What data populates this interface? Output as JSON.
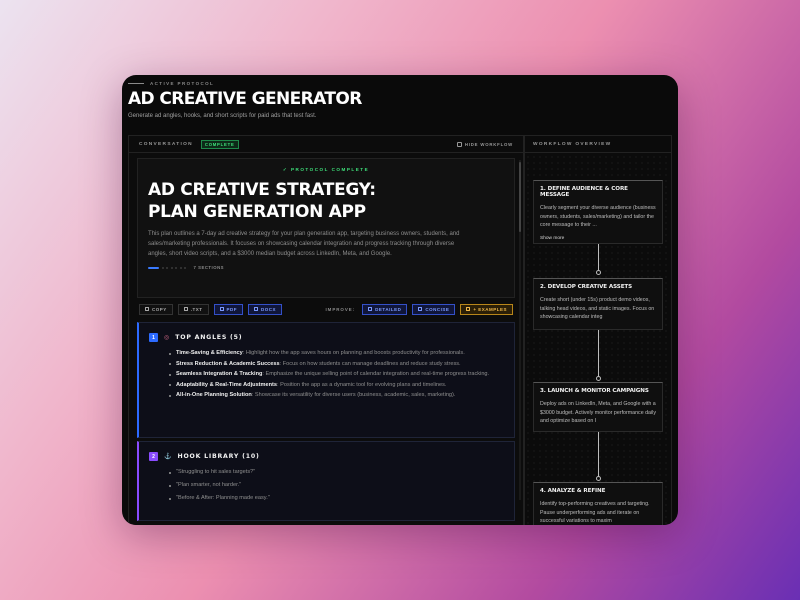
{
  "header": {
    "protocol_label": "ACTIVE PROTOCOL",
    "title": "AD CREATIVE GENERATOR",
    "subtitle": "Generate ad angles, hooks, and short scripts for paid ads that test fast."
  },
  "conversation": {
    "label": "CONVERSATION",
    "status": "COMPLETE",
    "hide_workflow": "HIDE WORKFLOW"
  },
  "hero": {
    "protocol_complete": "✓ PROTOCOL COMPLETE",
    "title": "AD CREATIVE STRATEGY: PLAN GENERATION APP",
    "description": "This plan outlines a 7-day ad creative strategy for your plan generation app, targeting business owners, students, and sales/marketing professionals. It focuses on showcasing calendar integration and progress tracking through diverse angles, short video scripts, and a $3000 median budget across LinkedIn, Meta, and Google.",
    "sections_label": "7 SECTIONS"
  },
  "toolbar": {
    "copy": "COPY",
    "txt": ".TXT",
    "pdf": "PDF",
    "docx": "DOCX",
    "improve_label": "IMPROVE:",
    "detailed": "DETAILED",
    "concise": "CONCISE",
    "examples": "+ EXAMPLES"
  },
  "sections": [
    {
      "number": "1",
      "title": "TOP ANGLES (5)",
      "items": [
        {
          "bold": "Time-Saving & Efficiency",
          "text": ": Highlight how the app saves hours on planning and boosts productivity for professionals."
        },
        {
          "bold": "Stress Reduction & Academic Success",
          "text": ": Focus on how students can manage deadlines and reduce study stress."
        },
        {
          "bold": "Seamless Integration & Tracking",
          "text": ": Emphasize the unique selling point of calendar integration and real-time progress tracking."
        },
        {
          "bold": "Adaptability & Real-Time Adjustments",
          "text": ": Position the app as a dynamic tool for evolving plans and timelines."
        },
        {
          "bold": "All-in-One Planning Solution",
          "text": ": Showcase its versatility for diverse users (business, academic, sales, marketing)."
        }
      ]
    },
    {
      "number": "2",
      "title": "HOOK LIBRARY (10)",
      "hooks": [
        "\"Struggling to hit sales targets?\"",
        "\"Plan smarter, not harder.\"",
        "\"Before & After: Planning made easy.\""
      ]
    }
  ],
  "workflow": {
    "label": "WORKFLOW OVERVIEW",
    "steps": [
      {
        "title": "1. DEFINE AUDIENCE & CORE MESSAGE",
        "body": "Clearly segment your diverse audience (business owners, students, sales/marketing) and tailor the core message to their ...",
        "show_more": "Show more"
      },
      {
        "title": "2. DEVELOP CREATIVE ASSETS",
        "body": "Create short (under 15s) product demo videos, talking head videos, and static images. Focus on showcasing calendar integ"
      },
      {
        "title": "3. LAUNCH & MONITOR CAMPAIGNS",
        "body": "Deploy ads on LinkedIn, Meta, and Google with a $3000 budget. Actively monitor performance daily and optimize based on I"
      },
      {
        "title": "4. ANALYZE & REFINE",
        "body": "Identify top-performing creatives and targeting. Pause underperforming ads and iterate on successful variations to maxim"
      }
    ]
  },
  "colors": {
    "accent_blue": "#2d6bff",
    "accent_purple": "#8a4cff",
    "success_green": "#3ee07a",
    "examples_orange": "#f0b84a"
  }
}
